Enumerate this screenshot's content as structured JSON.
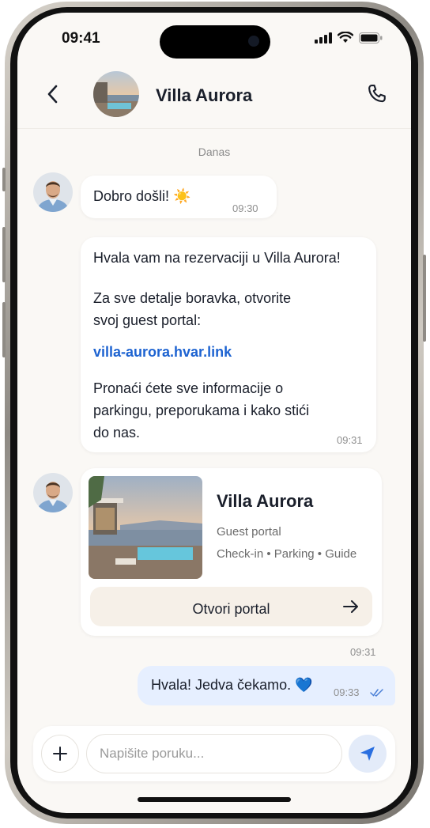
{
  "status": {
    "time": "09:41"
  },
  "header": {
    "title": "Villa Aurora"
  },
  "conversation": {
    "date_label": "Danas",
    "messages": [
      {
        "text": "Dobro došli! ☀️",
        "time": "09:30"
      },
      {
        "para1": "Hvala vam na rezervaciji u Villa Aurora!",
        "para2_line1": "Za sve detalje boravka, otvorite",
        "para2_line2": "svoj guest portal:",
        "link": "villa-aurora.hvar.link",
        "para3_line1": "Pronaći ćete sve informacije o",
        "para3_line2": "parkingu, preporukama i kako stići",
        "para3_line3": "do nas.",
        "time": "09:31"
      }
    ],
    "card": {
      "title": "Villa Aurora",
      "subtitle": "Guest portal",
      "features": "Check-in • Parking • Guide",
      "button_label": "Otvori portal",
      "time": "09:31"
    },
    "reply": {
      "text": "Hvala! Jedva čekamo. 💙",
      "time": "09:33"
    }
  },
  "composer": {
    "placeholder": "Napišite poruku..."
  },
  "colors": {
    "accent": "#1d63d1",
    "bubble_mine": "#e6efff",
    "background": "#faf8f5"
  }
}
